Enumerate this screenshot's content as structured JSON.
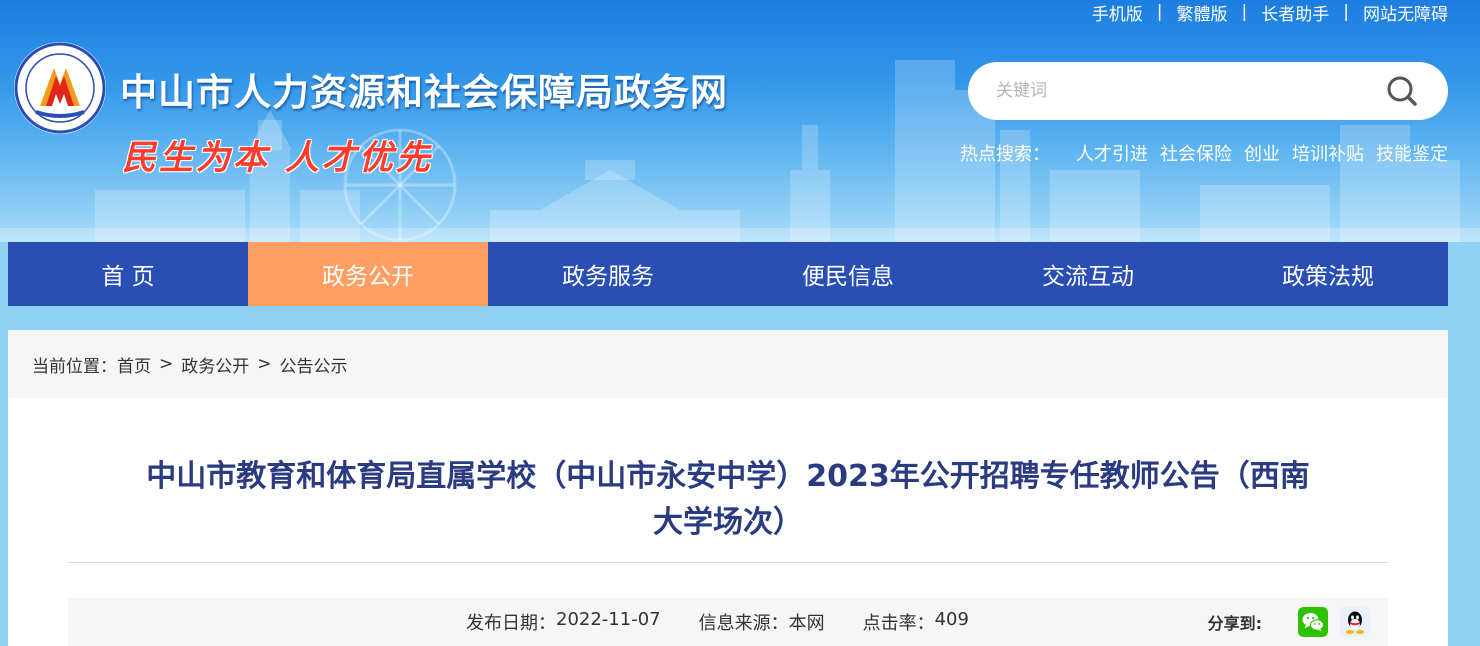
{
  "top_links": [
    "手机版",
    "繁體版",
    "长者助手",
    "网站无障碍"
  ],
  "top_link_separator": "|",
  "site_title": "中山市人力资源和社会保障局政务网",
  "slogan": "民生为本 人才优先",
  "search": {
    "placeholder": "关键词",
    "value": ""
  },
  "hot_search": {
    "label": "热点搜索：",
    "items": [
      "人才引进",
      "社会保险",
      "创业",
      "培训补贴",
      "技能鉴定"
    ]
  },
  "nav": {
    "items": [
      "首 页",
      "政务公开",
      "政务服务",
      "便民信息",
      "交流互动",
      "政策法规"
    ],
    "active_index": 1
  },
  "breadcrumb": {
    "label": "当前位置：",
    "items": [
      "首页",
      "政务公开",
      "公告公示"
    ],
    "separator": ">"
  },
  "article": {
    "title_line1": "中山市教育和体育局直属学校（中山市永安中学）2023年公开招聘专任教师公告（西南",
    "title_line2": "大学场次）",
    "publish_label": "发布日期：",
    "publish_date": "2022-11-07",
    "source_label": "信息来源：",
    "source": "本网",
    "clicks_label": "点击率：",
    "clicks": "409"
  },
  "share": {
    "label": "分享到:",
    "icons": [
      "wechat-icon",
      "qq-icon"
    ]
  },
  "colors": {
    "nav_bg": "#2a4fb4",
    "nav_active": "#ff9f63",
    "title_text": "#2a3b82",
    "slogan_red": "#ff3b2c",
    "page_bg": "#8fd0f5"
  }
}
